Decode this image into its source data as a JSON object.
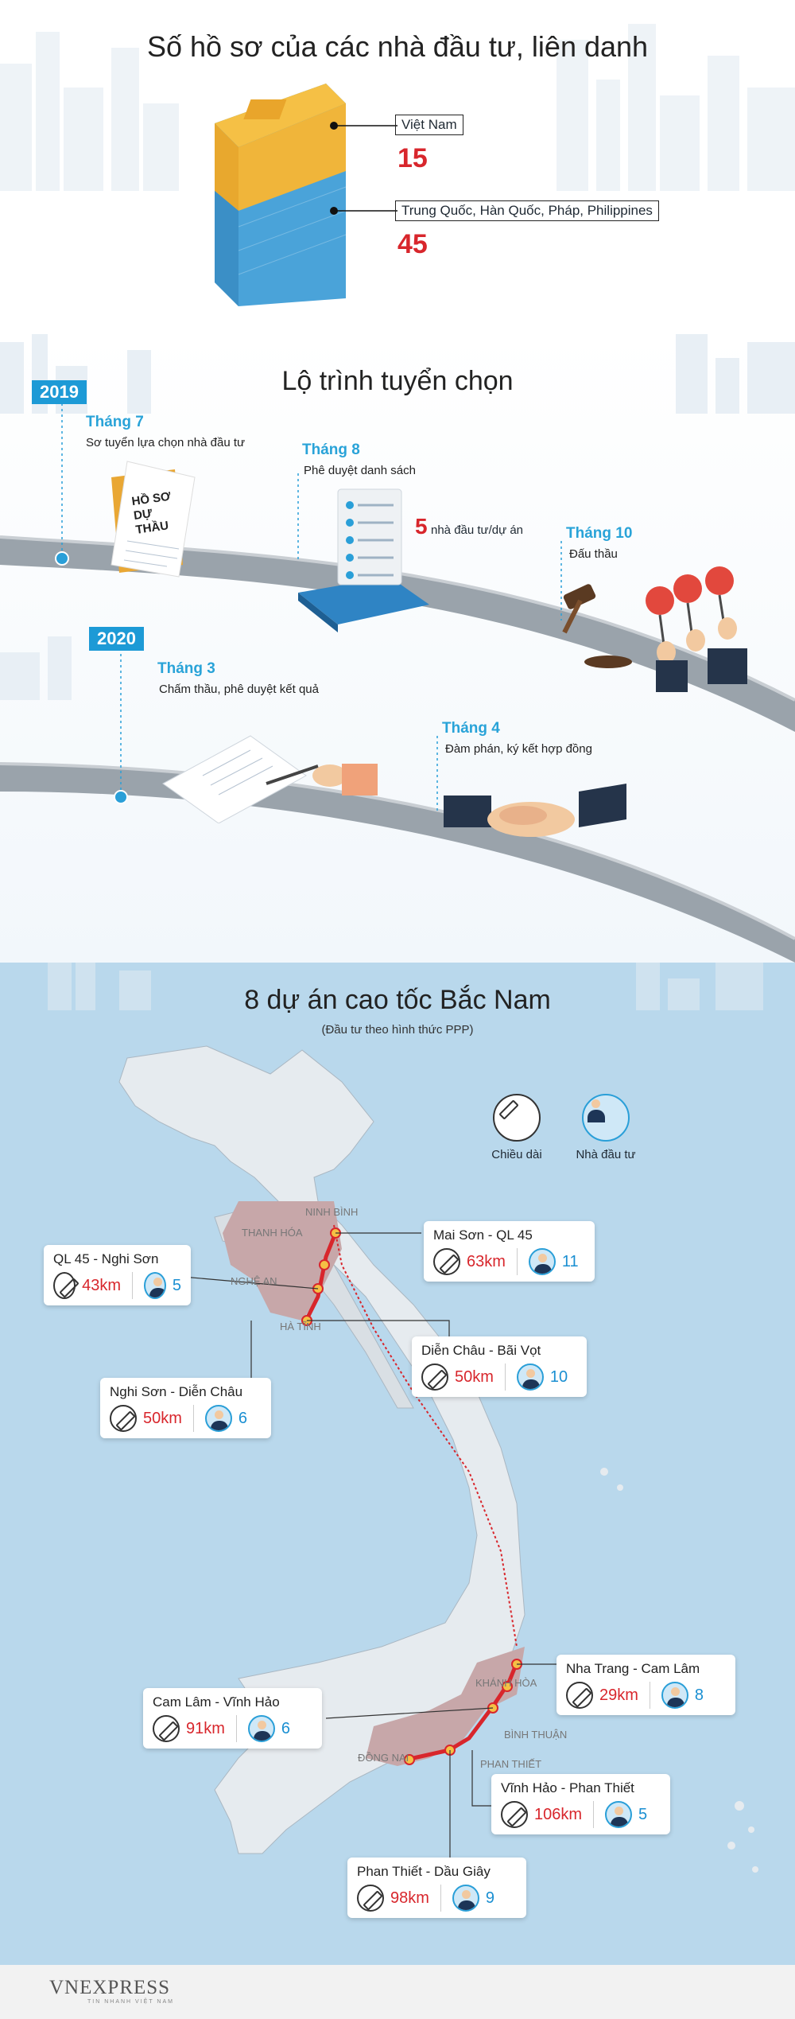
{
  "section1": {
    "title": "Số hồ sơ của các nhà đầu tư, liên danh",
    "groups": [
      {
        "label": "Việt Nam",
        "count": "15"
      },
      {
        "label": "Trung Quốc, Hàn Quốc, Pháp, Philippines",
        "count": "45"
      }
    ]
  },
  "section2": {
    "title": "Lộ trình tuyển chọn",
    "years": [
      "2019",
      "2020"
    ],
    "doc_label": "HỒ SƠ DỰ THẦU",
    "steps": [
      {
        "month": "Tháng 7",
        "desc": "Sơ tuyển lựa chọn nhà đầu tư"
      },
      {
        "month": "Tháng 8",
        "desc": "Phê duyệt danh sách"
      },
      {
        "month": "Tháng 10",
        "desc": "Đấu thầu"
      },
      {
        "month": "Tháng 3",
        "desc": "Chấm thầu, phê duyệt kết quả"
      },
      {
        "month": "Tháng 4",
        "desc": "Đàm phán, ký kết hợp đồng"
      }
    ],
    "shortlist_count": "5",
    "shortlist_label": "nhà đầu tư/dự án"
  },
  "section3": {
    "title": "8 dự án cao tốc Bắc Nam",
    "subtitle": "(Đầu tư theo hình thức PPP)",
    "legend": {
      "length": "Chiều dài",
      "investor": "Nhà đầu tư"
    },
    "provinces": [
      "NINH BÌNH",
      "THANH HÓA",
      "NGHỆ AN",
      "HÀ TĨNH",
      "KHÁNH HÒA",
      "BÌNH THUẬN",
      "PHAN THIẾT",
      "ĐỒNG NAI"
    ],
    "projects": [
      {
        "name": "QL 45 - Nghi Sơn",
        "length": "43km",
        "investors": "5"
      },
      {
        "name": "Mai Sơn - QL 45",
        "length": "63km",
        "investors": "11"
      },
      {
        "name": "Diễn Châu - Bãi Vọt",
        "length": "50km",
        "investors": "10"
      },
      {
        "name": "Nghi Sơn - Diễn Châu",
        "length": "50km",
        "investors": "6"
      },
      {
        "name": "Nha Trang - Cam Lâm",
        "length": "29km",
        "investors": "8"
      },
      {
        "name": "Cam Lâm - Vĩnh Hảo",
        "length": "91km",
        "investors": "6"
      },
      {
        "name": "Vĩnh Hảo - Phan Thiết",
        "length": "106km",
        "investors": "5"
      },
      {
        "name": "Phan Thiết - Dầu Giây",
        "length": "98km",
        "investors": "9"
      }
    ]
  },
  "footer": {
    "brand": "VNEXPRESS",
    "tagline": "TIN NHANH VIỆT NAM"
  },
  "colors": {
    "accent": "#1d9ad6",
    "highlight": "#d8262c",
    "sea": "#b9d8ec",
    "land": "#e6ebef",
    "route_region": "#c7a7a9"
  }
}
